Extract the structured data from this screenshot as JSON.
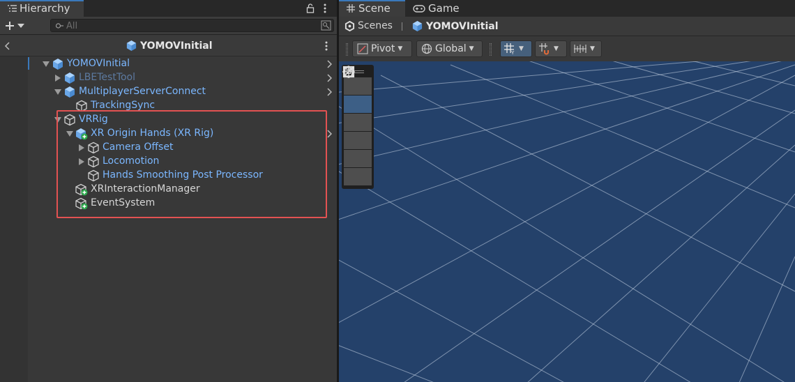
{
  "hierarchy": {
    "tab_label": "Hierarchy",
    "search_placeholder": "All",
    "scene_title": "YOMOVInitial",
    "items": [
      {
        "label": "YOMOVInitial",
        "depth": 0,
        "expanded": true,
        "has_children": true,
        "style": "blue",
        "icon": "unity-cube-blue-icon",
        "more": true
      },
      {
        "label": "LBETestTool",
        "depth": 1,
        "expanded": false,
        "has_children": true,
        "style": "dim",
        "icon": "prefab-cube-icon",
        "more": true
      },
      {
        "label": "MultiplayerServerConnect",
        "depth": 1,
        "expanded": true,
        "has_children": true,
        "style": "blue",
        "icon": "prefab-cube-icon",
        "more": true
      },
      {
        "label": "TrackingSync",
        "depth": 2,
        "expanded": false,
        "has_children": false,
        "style": "blue",
        "icon": "gameobject-cube-icon",
        "more": false
      },
      {
        "label": "VRRig",
        "depth": 1,
        "expanded": true,
        "has_children": true,
        "style": "blue",
        "icon": "gameobject-cube-icon",
        "more": false
      },
      {
        "label": "XR Origin Hands (XR Rig)",
        "depth": 2,
        "expanded": true,
        "has_children": true,
        "style": "blue",
        "icon": "prefab-added-icon",
        "more": true
      },
      {
        "label": "Camera Offset",
        "depth": 3,
        "expanded": false,
        "has_children": true,
        "style": "blue",
        "icon": "gameobject-cube-icon",
        "more": false
      },
      {
        "label": "Locomotion",
        "depth": 3,
        "expanded": false,
        "has_children": true,
        "style": "blue",
        "icon": "gameobject-cube-icon",
        "more": false
      },
      {
        "label": "Hands Smoothing Post Processor",
        "depth": 3,
        "expanded": false,
        "has_children": false,
        "style": "blue",
        "icon": "gameobject-cube-icon",
        "more": false
      },
      {
        "label": "XRInteractionManager",
        "depth": 2,
        "expanded": false,
        "has_children": false,
        "style": "white",
        "icon": "added-gameobject-icon",
        "more": false
      },
      {
        "label": "EventSystem",
        "depth": 2,
        "expanded": false,
        "has_children": false,
        "style": "white",
        "icon": "added-gameobject-icon",
        "more": false
      }
    ]
  },
  "scene": {
    "tab_scene": "Scene",
    "tab_game": "Game",
    "breadcrumb_root": "Scenes",
    "breadcrumb_current": "YOMOVInitial",
    "pivot_label": "Pivot",
    "global_label": "Global",
    "tools": [
      "hand-tool-icon",
      "move-tool-icon",
      "rotate-tool-icon",
      "scale-tool-icon",
      "rect-tool-icon",
      "transform-tool-icon"
    ],
    "active_tool": "move-tool-icon"
  },
  "colors": {
    "accent": "#3a79bb",
    "prefab_blue": "#7bb7ff",
    "viewport": "#24416a",
    "highlight": "#e35252"
  }
}
